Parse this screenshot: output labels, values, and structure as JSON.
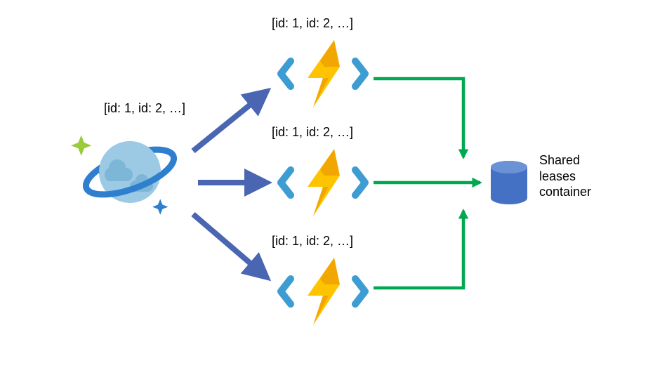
{
  "source_label": "[id: 1, id: 2, …]",
  "functions": [
    {
      "label": "[id: 1, id: 2, …]"
    },
    {
      "label": "[id: 1, id: 2, …]"
    },
    {
      "label": "[id: 1, id: 2, …]"
    }
  ],
  "sink_label": "Shared\nleases\ncontainer",
  "colors": {
    "blue_arrow": "#4A66B3",
    "green_arrow": "#00A850",
    "db_fill": "#4471C4",
    "func_bracket": "#3D9CD2",
    "bolt1": "#FFC400",
    "bolt2": "#F2A600",
    "planet_band": "#2F7FCE",
    "planet_body": "#9CC9E3",
    "planet_cloud": "#7DB6D6",
    "star_green": "#9BCB3C",
    "star_blue": "#2F7FCE"
  }
}
